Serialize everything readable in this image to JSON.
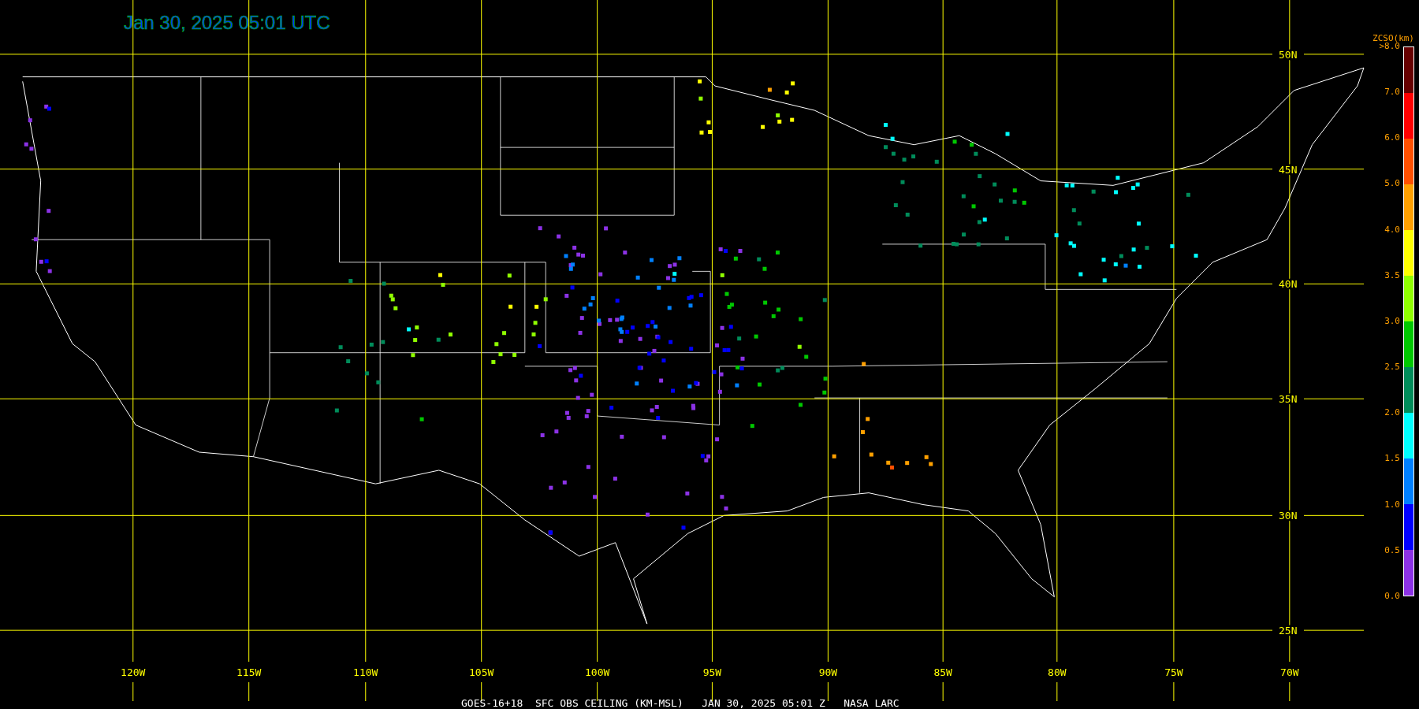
{
  "title": "Jan 30, 2025 05:01 UTC",
  "caption": "GOES-16+18  SFC OBS CEILING (KM-MSL)   JAN 30, 2025 05:01 Z   NASA LARC",
  "latitudes": [
    "50N",
    "45N",
    "40N",
    "35N",
    "30N",
    "25N"
  ],
  "longitudes": [
    "120W",
    "115W",
    "110W",
    "105W",
    "100W",
    "95W",
    "90W",
    "85W",
    "80W",
    "75W",
    "70W"
  ],
  "legend": {
    "title": "ZCSO(km)",
    "ticks": [
      ">8.0",
      "7.0",
      "6.0",
      "5.0",
      "4.0",
      "3.5",
      "3.0",
      "2.5",
      "2.0",
      "1.5",
      "1.0",
      "0.5",
      "0.0"
    ],
    "bins": [
      {
        "color": "#660000"
      },
      {
        "color": "#ff0000"
      },
      {
        "color": "#ff5000"
      },
      {
        "color": "#ffa000"
      },
      {
        "color": "#ffff00"
      },
      {
        "color": "#90ff00"
      },
      {
        "color": "#00c800"
      },
      {
        "color": "#008c5a"
      },
      {
        "color": "#00ffff"
      },
      {
        "color": "#0080ff"
      },
      {
        "color": "#0000ff"
      },
      {
        "color": "#8c32e6"
      }
    ]
  }
}
